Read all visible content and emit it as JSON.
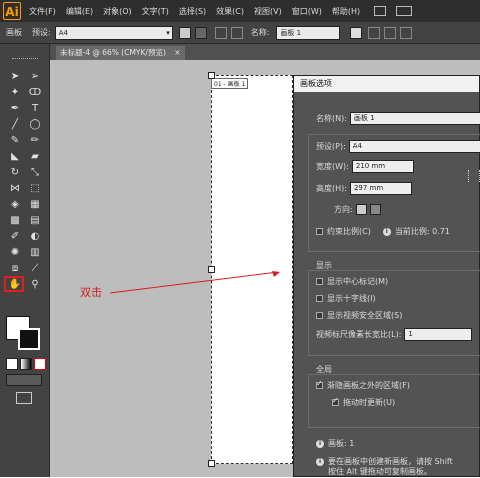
{
  "app": {
    "logo": "Ai",
    "accent": "#ff9a00"
  },
  "menu": [
    "文件(F)",
    "编辑(E)",
    "对象(O)",
    "文字(T)",
    "选择(S)",
    "效果(C)",
    "视图(V)",
    "窗口(W)",
    "帮助(H)"
  ],
  "control_bar": {
    "mode_label": "画板",
    "preset_label": "预设:",
    "preset_value": "A4",
    "name_label": "名称:",
    "name_value": "画板 1"
  },
  "document_tab": {
    "title": "未标题-4 @ 66% (CMYK/预览)",
    "close": "×"
  },
  "artboard": {
    "label": "01 - 画板 1"
  },
  "annotation": {
    "text": "双击",
    "color": "#d02020"
  },
  "dialog": {
    "title": "画板选项",
    "name_label": "名称(N):",
    "name_value": "画板 1",
    "preset_label": "预设(P):",
    "preset_value": "A4",
    "width_label": "宽度(W):",
    "width_value": "210 mm",
    "height_label": "高度(H):",
    "height_value": "297 mm",
    "orientation_label": "方向:",
    "constrain_label": "约束比例(C)",
    "ratio_label": "当前比例: 0.71",
    "display_title": "显示",
    "show_center": "显示中心标记(M)",
    "show_cross": "显示十字线(I)",
    "show_video_safe": "显示视频安全区域(S)",
    "pixel_ratio_label": "视频标尺像素长宽比(L):",
    "pixel_ratio_value": "1",
    "global_title": "全局",
    "fade_outside": "渐隐画板之外的区域(F)",
    "update_drag": "拖动时更新(U)",
    "artboards_count": "画板: 1",
    "tip_line1": "要在画板中创建新画板，请按 Shift",
    "tip_line2": "按住 Alt 键拖动可复制画板。"
  }
}
